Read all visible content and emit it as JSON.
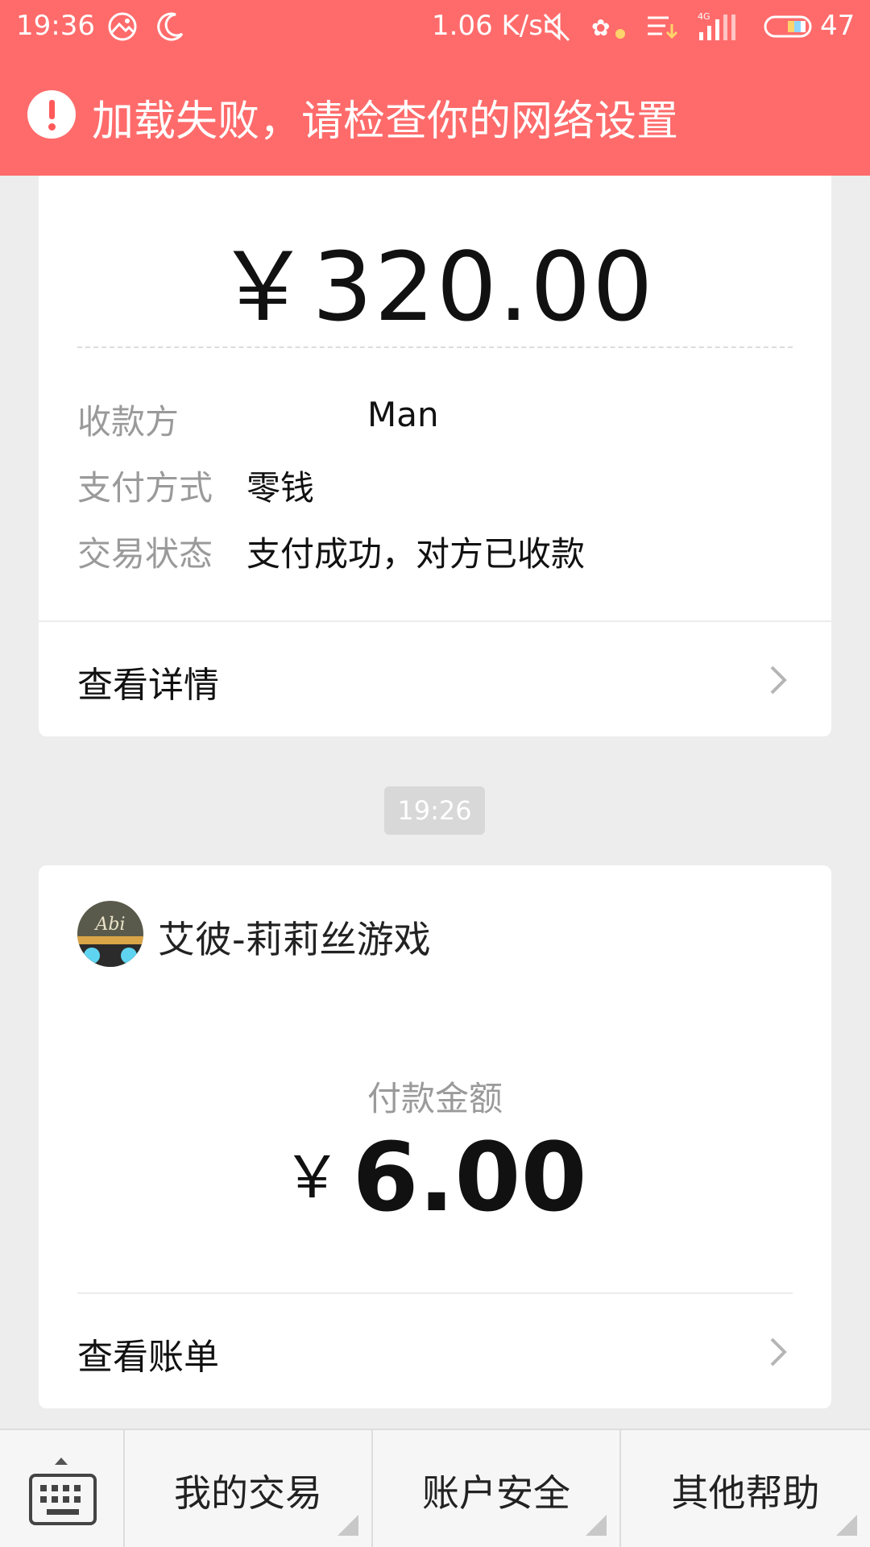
{
  "status_bar": {
    "time": "19:36",
    "net_speed": "1.06 K/s",
    "battery": "47",
    "icons": [
      "gallery-icon",
      "moon-icon",
      "mute-icon",
      "app-notification-icon",
      "notification-list-icon",
      "signal-4g-icon",
      "battery-icon"
    ]
  },
  "error_banner": {
    "text": "加载失败，请检查你的网络设置",
    "icon": "exclamation-circle-icon",
    "bg_color": "#ff6b6b"
  },
  "transfer_card": {
    "amount": "￥320.00",
    "rows": [
      {
        "label": "收款方",
        "value": "Man"
      },
      {
        "label": "支付方式",
        "value": "零钱"
      },
      {
        "label": "交易状态",
        "value": "支付成功，对方已收款"
      }
    ],
    "link_label": "查看详情"
  },
  "timestamp": "19:26",
  "payment_card": {
    "merchant_name": "艾彼-莉莉丝游戏",
    "avatar_text": "Abi",
    "amount_label": "付款金额",
    "currency": "￥",
    "amount": "6.00",
    "link_label": "查看账单"
  },
  "bottom_menu": {
    "keyboard_icon": "keyboard-icon",
    "items": [
      {
        "label": "我的交易"
      },
      {
        "label": "账户安全"
      },
      {
        "label": "其他帮助"
      }
    ]
  }
}
